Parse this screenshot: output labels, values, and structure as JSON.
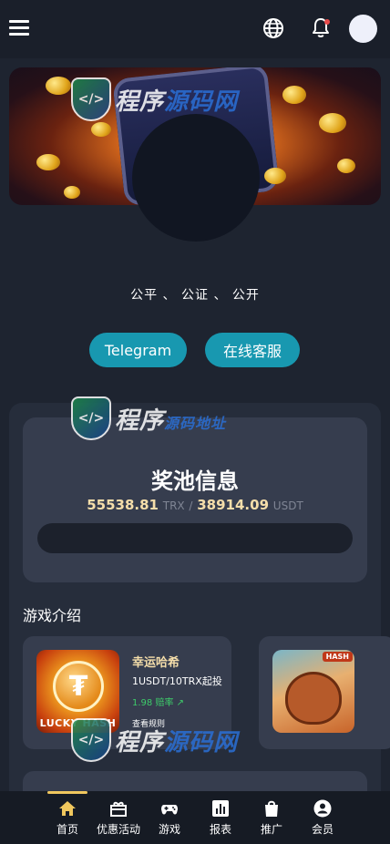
{
  "header": {
    "menu_icon": "hamburger-icon",
    "globe_icon": "globe-icon",
    "bell_icon": "bell-icon",
    "avatar": "avatar"
  },
  "watermark": {
    "cn_a": "程序",
    "cn_b": "源码网",
    "mid_text_a": "程序",
    "mid_text_b": "源码地址"
  },
  "motto": "公平 、 公证 、 公开",
  "buttons": {
    "telegram": "Telegram",
    "customer_service": "在线客服"
  },
  "jackpot": {
    "title": "奖池信息",
    "trx_value": "55538.81",
    "trx_unit": "TRX",
    "separator": "/",
    "usdt_value": "38914.09",
    "usdt_unit": "USDT"
  },
  "games_section": {
    "title": "游戏介绍",
    "items": [
      {
        "thumb_label": "LUCKY HASH",
        "name": "幸运哈希",
        "limit": "1USDT/10TRX起投",
        "odds": "1.98 赔率 ↗",
        "rules": "查看规则"
      },
      {
        "thumb_tag": "HASH"
      }
    ]
  },
  "bottom_nav": [
    {
      "label": "首页",
      "icon": "home-icon",
      "active": true
    },
    {
      "label": "优惠活动",
      "icon": "gift-icon",
      "active": false
    },
    {
      "label": "游戏",
      "icon": "gamepad-icon",
      "active": false
    },
    {
      "label": "报表",
      "icon": "bar-chart-icon",
      "active": false
    },
    {
      "label": "推广",
      "icon": "shopping-bag-icon",
      "active": false
    },
    {
      "label": "会员",
      "icon": "user-icon",
      "active": false
    }
  ],
  "colors": {
    "accent_teal": "#1898b0",
    "gold_text": "#f5deaa",
    "odds_green": "#3ecb6a",
    "nav_active": "#f0c75e"
  }
}
